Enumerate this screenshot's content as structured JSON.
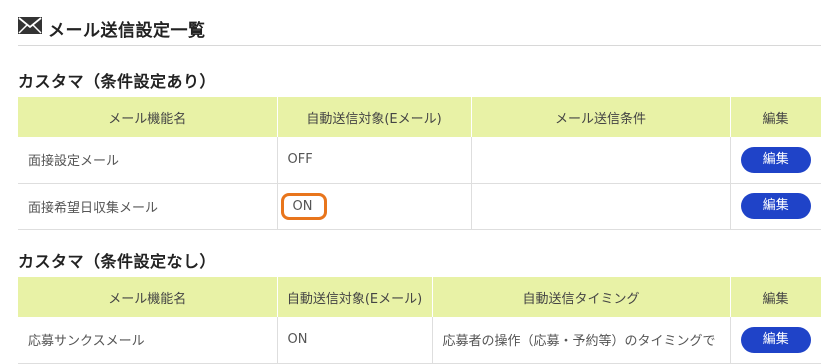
{
  "page": {
    "title": "メール送信設定一覧"
  },
  "sections": [
    {
      "title": "カスタマ（条件設定あり）",
      "headers": [
        "メール機能名",
        "自動送信対象(Eメール)",
        "メール送信条件",
        "編集"
      ],
      "rows": [
        {
          "name": "面接設定メール",
          "auto_send": "OFF",
          "condition": "",
          "edit_label": "編集"
        },
        {
          "name": "面接希望日収集メール",
          "auto_send": "ON",
          "condition": "",
          "edit_label": "編集"
        }
      ]
    },
    {
      "title": "カスタマ（条件設定なし）",
      "headers": [
        "メール機能名",
        "自動送信対象(Eメール)",
        "自動送信タイミング",
        "編集"
      ],
      "rows": [
        {
          "name": "応募サンクスメール",
          "auto_send": "ON",
          "timing": "応募者の操作（応募・予約等）のタイミングで",
          "edit_label": "編集"
        }
      ]
    }
  ],
  "colors": {
    "header_bg": "#e8f2a6",
    "button": "#1f43c8",
    "highlight": "#e8751c"
  },
  "icons": {
    "title_icon": "mail-icon"
  }
}
